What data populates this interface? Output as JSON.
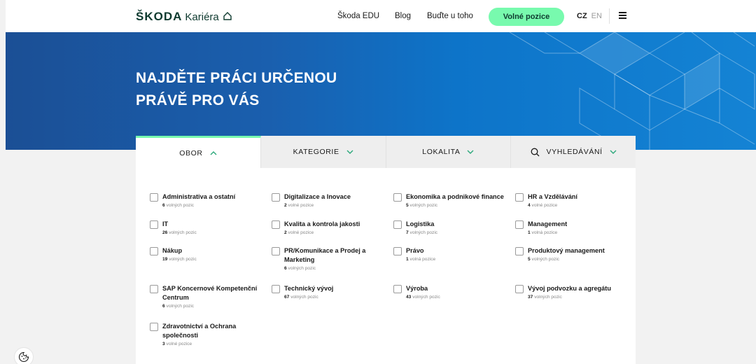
{
  "header": {
    "brand": "ŠKODA",
    "brand_sub": "Kariéra",
    "nav": {
      "edu": "Škoda EDU",
      "blog": "Blog",
      "budte": "Buďte u toho"
    },
    "cta": "Volné pozice",
    "lang": {
      "cz": "CZ",
      "en": "EN"
    }
  },
  "hero": {
    "line1": "NAJDĚTE PRÁCI URČENOU",
    "line2": "PRÁVĚ PRO VÁS"
  },
  "tabs": [
    {
      "label": "OBOR",
      "active": true
    },
    {
      "label": "KATEGORIE",
      "active": false
    },
    {
      "label": "LOKALITA",
      "active": false
    },
    {
      "label": "VYHLEDÁVÁNÍ",
      "active": false
    }
  ],
  "obor_items": [
    {
      "label": "Administrativa a ostatní",
      "count": "6",
      "suffix": "volných pozic"
    },
    {
      "label": "Digitalizace a Inovace",
      "count": "2",
      "suffix": "volné pozice"
    },
    {
      "label": "Ekonomika a podnikové finance",
      "count": "5",
      "suffix": "volných pozic"
    },
    {
      "label": "HR a Vzdělávání",
      "count": "4",
      "suffix": "volné pozice"
    },
    {
      "label": "IT",
      "count": "26",
      "suffix": "volných pozic"
    },
    {
      "label": "Kvalita a kontrola jakosti",
      "count": "2",
      "suffix": "volné pozice"
    },
    {
      "label": "Logistika",
      "count": "7",
      "suffix": "volných pozic"
    },
    {
      "label": "Management",
      "count": "1",
      "suffix": "volná pozice"
    },
    {
      "label": "Nákup",
      "count": "19",
      "suffix": "volných pozic"
    },
    {
      "label": "PR/Komunikace a Prodej a Marketing",
      "count": "6",
      "suffix": "volných pozic"
    },
    {
      "label": "Právo",
      "count": "1",
      "suffix": "volná pozice"
    },
    {
      "label": "Produktový management",
      "count": "5",
      "suffix": "volných pozic"
    },
    {
      "label": "SAP Koncernové Kompetenční Centrum",
      "count": "6",
      "suffix": "volných pozic"
    },
    {
      "label": "Technický vývoj",
      "count": "67",
      "suffix": "volných pozic"
    },
    {
      "label": "Výroba",
      "count": "43",
      "suffix": "volných pozic"
    },
    {
      "label": "Vývoj podvozku a agregátu",
      "count": "37",
      "suffix": "volných pozic"
    },
    {
      "label": "Zdravotnictví a Ochrana společnosti",
      "count": "3",
      "suffix": "volné pozice"
    }
  ],
  "colors": {
    "accent": "#78faae",
    "brand": "#0e3a2f",
    "hero": "#1a5fae"
  },
  "icons": {
    "home": "home-icon",
    "menu": "hamburger-menu-icon",
    "search": "search-icon",
    "cookie": "cookie-icon"
  }
}
